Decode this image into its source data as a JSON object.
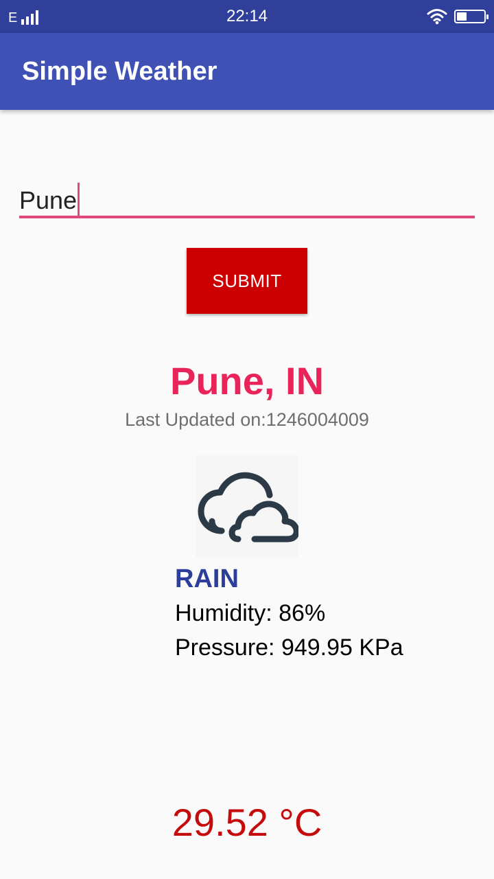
{
  "status_bar": {
    "network_type": "E",
    "time": "22:14",
    "signal_icon": "cellular-signal-icon",
    "wifi_icon": "wifi-icon",
    "battery_icon": "battery-icon"
  },
  "app_bar": {
    "title": "Simple Weather",
    "color": "#3f51b5"
  },
  "search": {
    "value": "Pune",
    "accent_color": "#e0497c"
  },
  "submit": {
    "label": "SUBMIT",
    "color": "#cc0000"
  },
  "weather": {
    "city": "Pune, IN",
    "last_updated": "Last Updated on:1246004009",
    "icon": "cloud-icon",
    "condition": "RAIN",
    "humidity": "Humidity: 86%",
    "pressure": "Pressure: 949.95 KPa",
    "temperature": "29.52 °C"
  }
}
